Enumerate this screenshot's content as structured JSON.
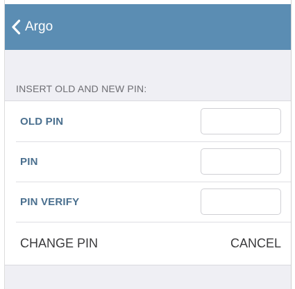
{
  "navbar": {
    "back_label": "Argo",
    "back_icon": "chevron-left-icon",
    "background": "#5b8db3"
  },
  "section": {
    "header": "INSERT OLD AND NEW PIN:"
  },
  "fields": [
    {
      "label": "OLD PIN",
      "value": ""
    },
    {
      "label": "PIN",
      "value": ""
    },
    {
      "label": "PIN VERIFY",
      "value": ""
    }
  ],
  "actions": {
    "change_pin": "CHANGE PIN",
    "cancel": "CANCEL"
  },
  "colors": {
    "label_accent": "#4a6f8e",
    "page_background": "#efeff4"
  }
}
